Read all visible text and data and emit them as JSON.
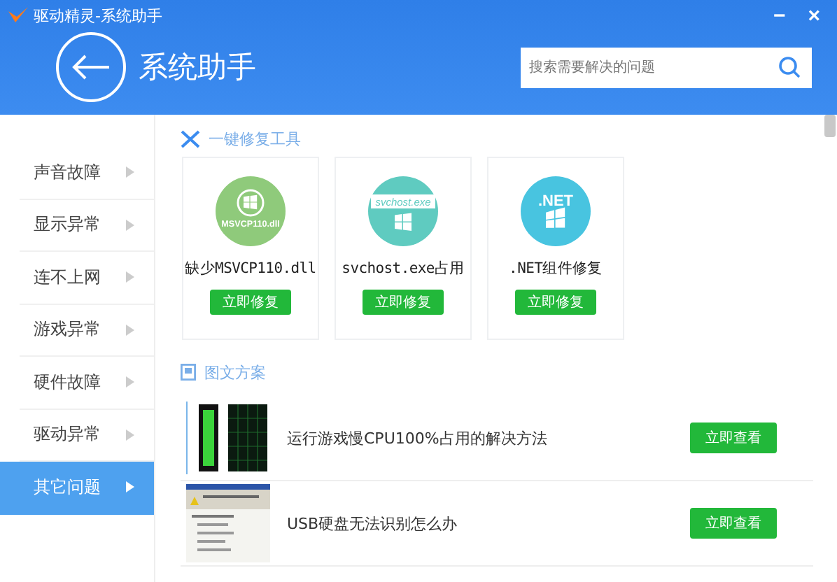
{
  "window": {
    "title": "驱动精灵-系统助手",
    "minimize": "−",
    "close": "×"
  },
  "header": {
    "title": "系统助手",
    "search": {
      "placeholder": "搜索需要解决的问题"
    }
  },
  "sidebar": {
    "items": [
      {
        "label": "声音故障",
        "selected": false
      },
      {
        "label": "显示异常",
        "selected": false
      },
      {
        "label": "连不上网",
        "selected": false
      },
      {
        "label": "游戏异常",
        "selected": false
      },
      {
        "label": "硬件故障",
        "selected": false
      },
      {
        "label": "驱动异常",
        "selected": false
      },
      {
        "label": "其它问题",
        "selected": true
      }
    ]
  },
  "repair_tools": {
    "title": "一键修复工具",
    "cards": [
      {
        "kind": "dll",
        "badge": "MSVCP110.dll",
        "color": "#8fca7b",
        "label": "缺少MSVCP110.dll",
        "button": "立即修复"
      },
      {
        "kind": "exe",
        "badge": "svchost.exe",
        "color": "#5fcbc0",
        "label": "svchost.exe占用",
        "button": "立即修复"
      },
      {
        "kind": "net",
        "badge": ".NET",
        "color": "#48c4e0",
        "label": ".NET组件修复",
        "button": "立即修复"
      }
    ]
  },
  "guides": {
    "title": "图文方案",
    "rows": [
      {
        "kind": "meter",
        "title": "运行游戏慢CPU100%占用的解决方法",
        "button": "立即查看"
      },
      {
        "kind": "dialog",
        "title": "USB硬盘无法识别怎么办",
        "button": "立即查看"
      }
    ]
  }
}
